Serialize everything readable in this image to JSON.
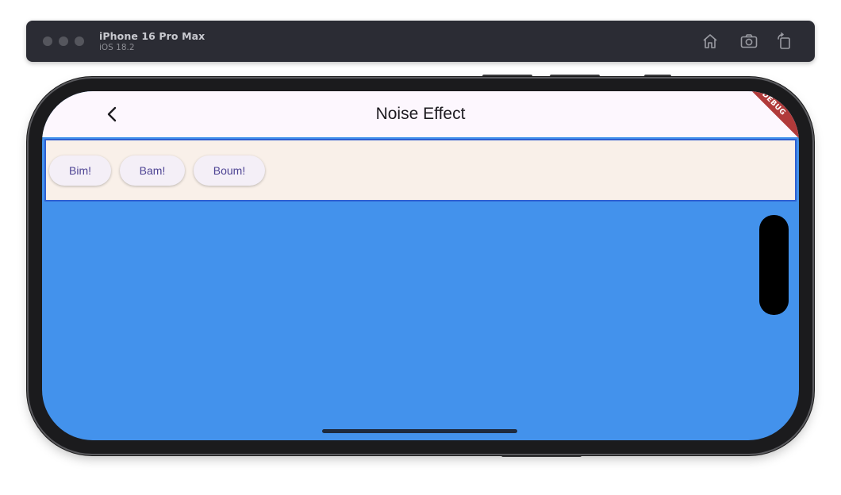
{
  "simulator": {
    "device_name": "iPhone 16 Pro Max",
    "os_version": "iOS 18.2",
    "icons": [
      "home-icon",
      "screenshot-icon",
      "rotate-icon"
    ]
  },
  "app": {
    "title": "Noise Effect",
    "debug_banner": "DEBUG",
    "buttons": [
      "Bim!",
      "Bam!",
      "Boum!"
    ]
  },
  "colors": {
    "background": "#4392ec",
    "appbar": "#fdf7fe",
    "panel": "#f9f0e9",
    "panel_border": "#2f5fd1",
    "button_text": "#4e4494",
    "debug_ribbon": "#b13a3a"
  }
}
